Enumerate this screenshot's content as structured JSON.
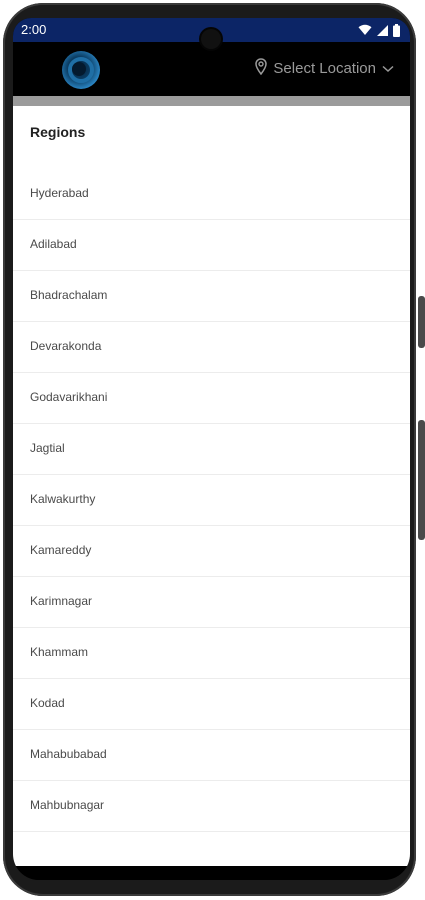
{
  "status_bar": {
    "time": "2:00",
    "icons": [
      "wifi-icon",
      "signal-icon",
      "battery-icon"
    ]
  },
  "header": {
    "logo": "app-logo",
    "location_label": "Select Location",
    "location_icon": "map-pin-icon",
    "dropdown_icon": "chevron-down-icon"
  },
  "regions": {
    "title": "Regions",
    "items": [
      "Hyderabad",
      "Adilabad",
      "Bhadrachalam",
      "Devarakonda",
      "Godavarikhani",
      "Jagtial",
      "Kalwakurthy",
      "Kamareddy",
      "Karimnagar",
      "Khammam",
      "Kodad",
      "Mahabubabad",
      "Mahbubnagar"
    ]
  },
  "colors": {
    "status_bar": "#0c2566",
    "header": "#000000",
    "logo_blue": "#1f6fa6",
    "list_text": "#4a4a4a",
    "divider": "#ececec"
  }
}
